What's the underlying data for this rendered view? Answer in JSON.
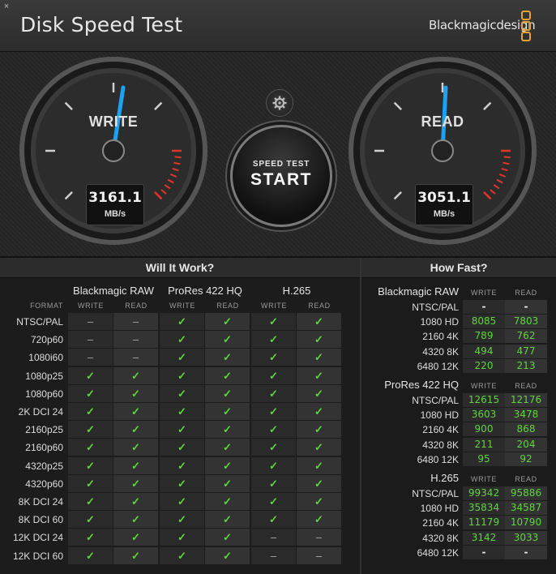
{
  "window": {
    "title": "Disk Speed Test",
    "brand": "Blackmagicdesign",
    "close_icon": "×"
  },
  "gauges": {
    "write": {
      "label": "WRITE",
      "value": "3161.1",
      "unit": "MB/s"
    },
    "read": {
      "label": "READ",
      "value": "3051.1",
      "unit": "MB/s"
    }
  },
  "start_button": {
    "line1": "SPEED TEST",
    "line2": "START"
  },
  "will_it_work": {
    "title": "Will It Work?",
    "format_label": "FORMAT",
    "codecs": [
      "Blackmagic RAW",
      "ProRes 422 HQ",
      "H.265"
    ],
    "sublabels": [
      "WRITE",
      "READ"
    ],
    "rows": [
      {
        "format": "NTSC/PAL",
        "cells": [
          "–",
          "–",
          "✓",
          "✓",
          "✓",
          "✓"
        ]
      },
      {
        "format": "720p60",
        "cells": [
          "–",
          "–",
          "✓",
          "✓",
          "✓",
          "✓"
        ]
      },
      {
        "format": "1080i60",
        "cells": [
          "–",
          "–",
          "✓",
          "✓",
          "✓",
          "✓"
        ]
      },
      {
        "format": "1080p25",
        "cells": [
          "✓",
          "✓",
          "✓",
          "✓",
          "✓",
          "✓"
        ]
      },
      {
        "format": "1080p60",
        "cells": [
          "✓",
          "✓",
          "✓",
          "✓",
          "✓",
          "✓"
        ]
      },
      {
        "format": "2K DCI 24",
        "cells": [
          "✓",
          "✓",
          "✓",
          "✓",
          "✓",
          "✓"
        ]
      },
      {
        "format": "2160p25",
        "cells": [
          "✓",
          "✓",
          "✓",
          "✓",
          "✓",
          "✓"
        ]
      },
      {
        "format": "2160p60",
        "cells": [
          "✓",
          "✓",
          "✓",
          "✓",
          "✓",
          "✓"
        ]
      },
      {
        "format": "4320p25",
        "cells": [
          "✓",
          "✓",
          "✓",
          "✓",
          "✓",
          "✓"
        ]
      },
      {
        "format": "4320p60",
        "cells": [
          "✓",
          "✓",
          "✓",
          "✓",
          "✓",
          "✓"
        ]
      },
      {
        "format": "8K DCI 24",
        "cells": [
          "✓",
          "✓",
          "✓",
          "✓",
          "✓",
          "✓"
        ]
      },
      {
        "format": "8K DCI 60",
        "cells": [
          "✓",
          "✓",
          "✓",
          "✓",
          "✓",
          "✓"
        ]
      },
      {
        "format": "12K DCI 24",
        "cells": [
          "✓",
          "✓",
          "✓",
          "✓",
          "–",
          "–"
        ]
      },
      {
        "format": "12K DCI 60",
        "cells": [
          "✓",
          "✓",
          "✓",
          "✓",
          "–",
          "–"
        ]
      }
    ]
  },
  "how_fast": {
    "title": "How Fast?",
    "sublabels": [
      "WRITE",
      "READ"
    ],
    "sections": [
      {
        "codec": "Blackmagic RAW",
        "rows": [
          {
            "format": "NTSC/PAL",
            "write": "-",
            "read": "-"
          },
          {
            "format": "1080 HD",
            "write": "8085",
            "read": "7803"
          },
          {
            "format": "2160 4K",
            "write": "789",
            "read": "762"
          },
          {
            "format": "4320 8K",
            "write": "494",
            "read": "477"
          },
          {
            "format": "6480 12K",
            "write": "220",
            "read": "213"
          }
        ]
      },
      {
        "codec": "ProRes 422 HQ",
        "rows": [
          {
            "format": "NTSC/PAL",
            "write": "12615",
            "read": "12176"
          },
          {
            "format": "1080 HD",
            "write": "3603",
            "read": "3478"
          },
          {
            "format": "2160 4K",
            "write": "900",
            "read": "868"
          },
          {
            "format": "4320 8K",
            "write": "211",
            "read": "204"
          },
          {
            "format": "6480 12K",
            "write": "95",
            "read": "92"
          }
        ]
      },
      {
        "codec": "H.265",
        "rows": [
          {
            "format": "NTSC/PAL",
            "write": "99342",
            "read": "95886"
          },
          {
            "format": "1080 HD",
            "write": "35834",
            "read": "34587"
          },
          {
            "format": "2160 4K",
            "write": "11179",
            "read": "10790"
          },
          {
            "format": "4320 8K",
            "write": "3142",
            "read": "3033"
          },
          {
            "format": "6480 12K",
            "write": "-",
            "read": "-"
          }
        ]
      }
    ]
  },
  "colors": {
    "accent": "#5fd53f",
    "needle": "#1aa3f5",
    "redzone": "#e0352b",
    "brand_logo": "#e4a23a"
  }
}
